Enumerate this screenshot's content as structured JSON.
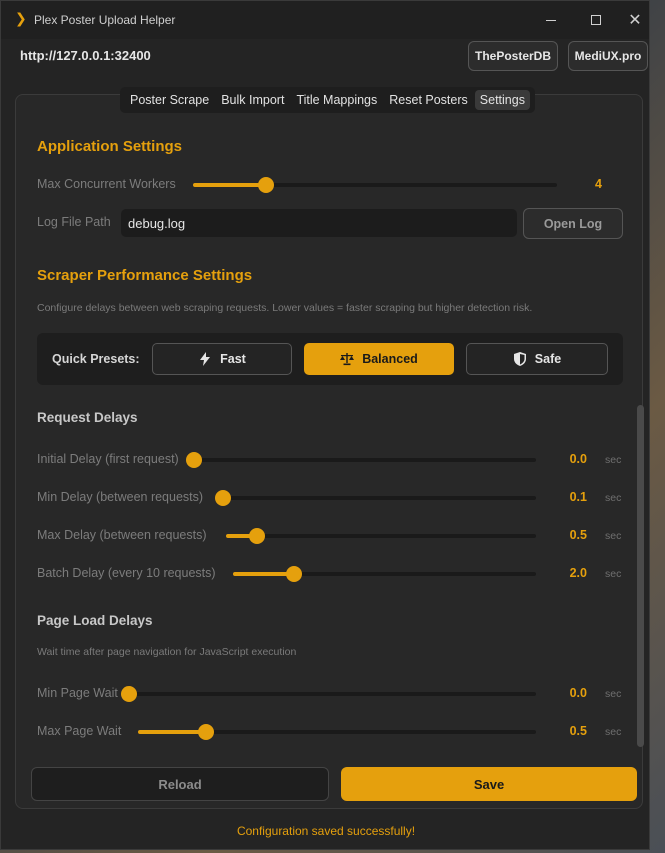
{
  "window": {
    "title": "Plex Poster Upload Helper",
    "accent": "#e5a00d",
    "controls": [
      "minimize-icon",
      "maximize-icon",
      "close-icon"
    ]
  },
  "header": {
    "server_url": "http://127.0.0.1:32400",
    "buttons": [
      "ThePosterDB",
      "MediUX.pro"
    ]
  },
  "tabs": [
    {
      "label": "Poster Scrape",
      "active": false
    },
    {
      "label": "Bulk Import",
      "active": false
    },
    {
      "label": "Title Mappings",
      "active": false
    },
    {
      "label": "Reset Posters",
      "active": false
    },
    {
      "label": "Settings",
      "active": true
    }
  ],
  "app_settings": {
    "title": "Application Settings",
    "workers": {
      "label": "Max Concurrent Workers",
      "value": "4",
      "fraction": 0.2
    },
    "log": {
      "label": "Log File Path",
      "value": "debug.log",
      "button": "Open Log"
    }
  },
  "scraper": {
    "title": "Scraper Performance Settings",
    "description": "Configure delays between web scraping requests. Lower values = faster scraping but higher detection risk.",
    "presets_label": "Quick Presets:",
    "presets": [
      {
        "label": "Fast",
        "icon": "lightning-icon",
        "active": false
      },
      {
        "label": "Balanced",
        "icon": "balance-scale-icon",
        "active": true
      },
      {
        "label": "Safe",
        "icon": "shield-icon",
        "active": false
      }
    ]
  },
  "request_delays": {
    "title": "Request Delays",
    "unit": "sec",
    "rows": [
      {
        "label": "Initial Delay (first request)",
        "value": "0.0",
        "fraction": 0.0
      },
      {
        "label": "Min Delay (between requests)",
        "value": "0.1",
        "fraction": 0.0
      },
      {
        "label": "Max Delay (between requests)",
        "value": "0.5",
        "fraction": 0.1
      },
      {
        "label": "Batch Delay (every 10 requests)",
        "value": "2.0",
        "fraction": 0.2
      }
    ]
  },
  "page_load": {
    "title": "Page Load Delays",
    "description": "Wait time after page navigation for JavaScript execution",
    "unit": "sec",
    "rows": [
      {
        "label": "Min Page Wait",
        "value": "0.0",
        "fraction": 0.0
      },
      {
        "label": "Max Page Wait",
        "value": "0.5",
        "fraction": 0.17
      }
    ]
  },
  "footer": {
    "reload": "Reload",
    "save": "Save",
    "status": "Configuration saved successfully!"
  }
}
